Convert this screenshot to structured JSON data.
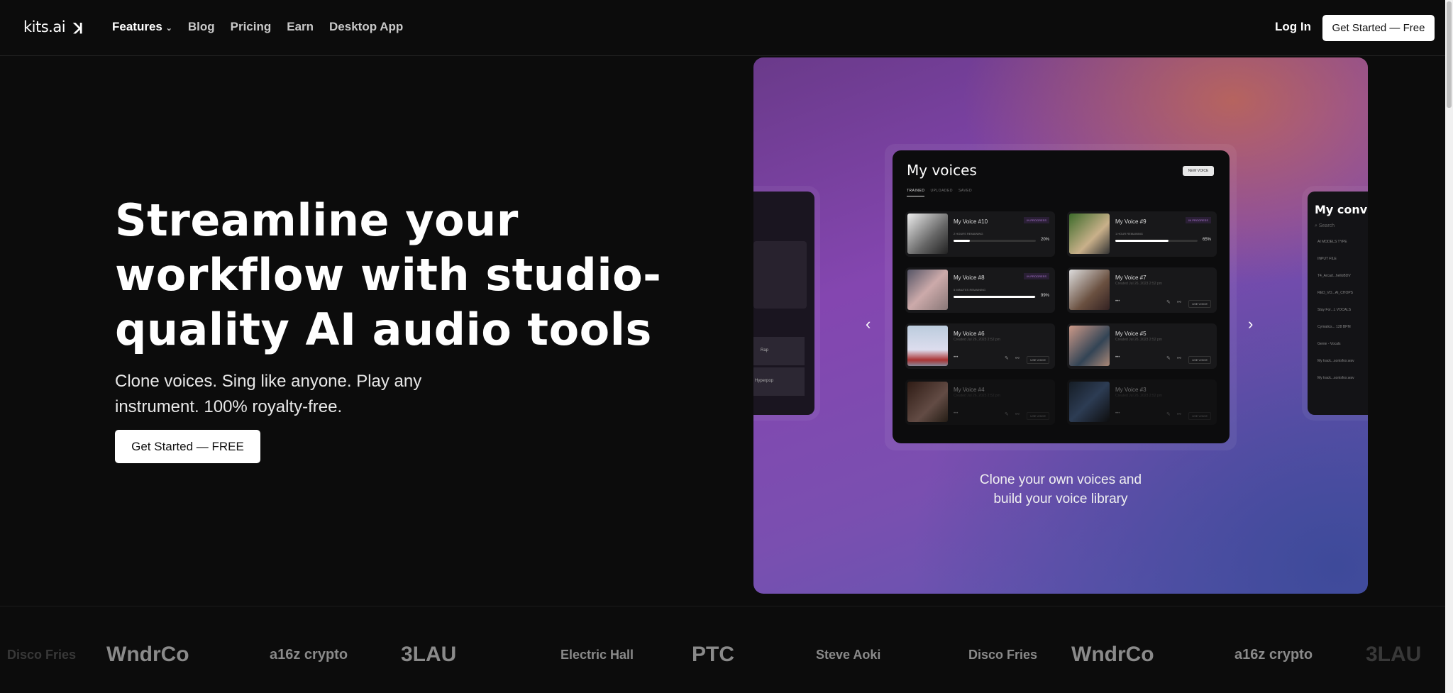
{
  "nav": {
    "logo": "kits.ai",
    "logo_mark": "ꓘ",
    "items": [
      {
        "label": "Features",
        "has_dropdown": true
      },
      {
        "label": "Blog"
      },
      {
        "label": "Pricing"
      },
      {
        "label": "Earn"
      },
      {
        "label": "Desktop App"
      }
    ],
    "login": "Log In",
    "get_started": "Get Started — Free"
  },
  "hero": {
    "title": "Streamline your workflow with studio-quality AI audio tools",
    "subtitle": "Clone voices. Sing like anyone. Play any instrument.  100% royalty-free.",
    "cta": "Get Started — FREE"
  },
  "showcase": {
    "caption_line1": "Clone your own voices and",
    "caption_line2": "build your voice library",
    "voices_card": {
      "title": "My voices",
      "new_voice": "NEW VOICE",
      "tabs": [
        "TRAINED",
        "UPLOADED",
        "SAVED"
      ],
      "voices": [
        {
          "name": "My Voice #10",
          "status": "IN PROGRESS",
          "remaining": "2 HOURS REMAINING",
          "progress": 20,
          "progress_label": "20%"
        },
        {
          "name": "My Voice #9",
          "status": "IN PROGRESS",
          "remaining": "1 HOUR REMAINING",
          "progress": 65,
          "progress_label": "65%"
        },
        {
          "name": "My Voice #8",
          "status": "IN PROGRESS",
          "remaining": "5 MINUTES REMAINING",
          "progress": 99,
          "progress_label": "99%"
        },
        {
          "name": "My Voice #7",
          "created": "Created Jul 26, 2023 2:52 pm",
          "use": "USE VOICE"
        },
        {
          "name": "My Voice #6",
          "created": "Created Jul 26, 2023 2:52 pm",
          "use": "USE VOICE"
        },
        {
          "name": "My Voice #5",
          "created": "Created Jul 26, 2023 2:52 pm",
          "use": "USE VOICE"
        },
        {
          "name": "My Voice #4",
          "created": "Created Jul 26, 2023 2:52 pm",
          "use": "USE VOICE"
        },
        {
          "name": "My Voice #3",
          "created": "Created Jul 26, 2023 2:52 pm",
          "use": "USE VOICE"
        }
      ]
    },
    "left_card": {
      "rows": [
        "Rap",
        "Hyperpop"
      ]
    },
    "conversions_card": {
      "title": "My conversions",
      "search": "Search",
      "filter": "AI MODELS TYPE",
      "column": "INPUT FILE",
      "rows": [
        "T4_Arcad...helloBDV",
        "RED_VO...AI_CHOPS",
        "Stay For...L VOCALS",
        "Cymatics... 128 BPM",
        "Genie - Vocals",
        "My track...sonisfox.wav",
        "My track...sonisfox.wav"
      ]
    }
  },
  "logos": [
    "Disco Fries",
    "WndrCo",
    "a16z crypto",
    "3LAU",
    "Electric Hall",
    "PTC",
    "Steve Aoki",
    "Disco Fries",
    "WndrCo",
    "a16z crypto",
    "3LAU"
  ],
  "colors": {
    "background": "#0c0c0c",
    "accent_purple": "#8446b0",
    "tag_purple": "#b07ad8"
  }
}
